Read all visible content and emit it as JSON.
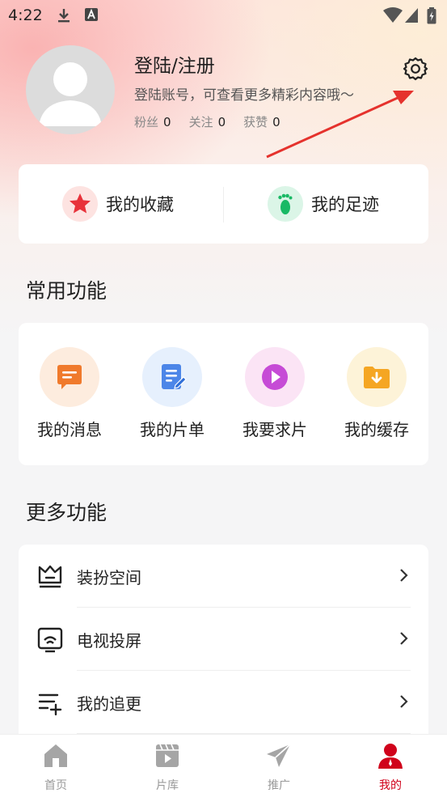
{
  "status_bar": {
    "time": "4:22",
    "icons": [
      "download-icon",
      "a-badge-icon",
      "wifi-icon",
      "signal-icon",
      "battery-icon"
    ]
  },
  "profile": {
    "name": "登陆/注册",
    "tagline": "登陆账号，可查看更多精彩内容哦～",
    "stats": [
      {
        "label": "粉丝",
        "value": "0"
      },
      {
        "label": "关注",
        "value": "0"
      },
      {
        "label": "获赞",
        "value": "0"
      }
    ]
  },
  "quick": [
    {
      "label": "我的收藏",
      "icon": "star-icon"
    },
    {
      "label": "我的足迹",
      "icon": "footprint-icon"
    }
  ],
  "common_title": "常用功能",
  "funcs": [
    {
      "label": "我的消息",
      "icon": "message-icon"
    },
    {
      "label": "我的片单",
      "icon": "playlist-icon"
    },
    {
      "label": "我要求片",
      "icon": "play-icon"
    },
    {
      "label": "我的缓存",
      "icon": "download-folder-icon"
    }
  ],
  "more_title": "更多功能",
  "more": [
    {
      "label": "装扮空间",
      "icon": "crown-icon"
    },
    {
      "label": "电视投屏",
      "icon": "cast-icon"
    },
    {
      "label": "我的追更",
      "icon": "list-add-icon"
    }
  ],
  "tabs": [
    {
      "label": "首页",
      "icon": "home-icon"
    },
    {
      "label": "片库",
      "icon": "film-icon"
    },
    {
      "label": "推广",
      "icon": "paper-plane-icon"
    },
    {
      "label": "我的",
      "icon": "user-icon"
    }
  ],
  "colors": {
    "accent": "#d0021b",
    "annotation_arrow": "#e5322d"
  }
}
